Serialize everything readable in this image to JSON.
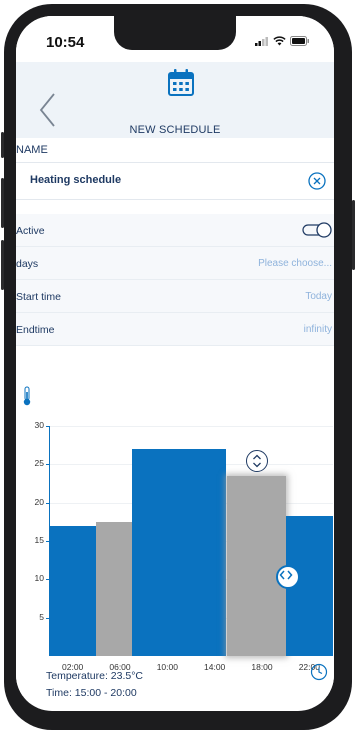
{
  "status": {
    "time": "10:54"
  },
  "nav": {
    "title": "NEW SCHEDULE"
  },
  "form": {
    "name_label": "NAME",
    "name_value": "Heating schedule",
    "rows": [
      {
        "label": "Active",
        "value": ""
      },
      {
        "label": "days",
        "value": "Please choose..."
      },
      {
        "label": "Start time",
        "value": "Today"
      },
      {
        "label": "Endtime",
        "value": "infinity"
      }
    ],
    "active": true
  },
  "chart_data": {
    "type": "bar",
    "title": "",
    "xlabel": "",
    "ylabel": "",
    "ylim": [
      0,
      30
    ],
    "yticks": [
      "30",
      "25",
      "20",
      "15",
      "10",
      "5"
    ],
    "xticks": [
      "02:00",
      "06:00",
      "10:00",
      "14:00",
      "18:00",
      "22:00"
    ],
    "segments": [
      {
        "start": 0,
        "end": 4,
        "value": 17,
        "color": "#0a72bf"
      },
      {
        "start": 4,
        "end": 7,
        "value": 17.5,
        "color": "#a8a8a8"
      },
      {
        "start": 7,
        "end": 11.5,
        "value": 27,
        "color": "#0a72bf"
      },
      {
        "start": 11.5,
        "end": 15,
        "value": 27,
        "color": "#0a72bf"
      },
      {
        "start": 15,
        "end": 20,
        "value": 23.5,
        "color": "#a8a8a8",
        "selected": true
      },
      {
        "start": 20,
        "end": 24,
        "value": 18.2,
        "color": "#0a72bf"
      }
    ]
  },
  "info": {
    "temperature": "Temperature: 23.5°C",
    "time": "Time: 15:00 - 20:00"
  },
  "colors": {
    "accent": "#0a72bf",
    "inactive": "#a8a8a8",
    "text": "#1f3a63"
  }
}
